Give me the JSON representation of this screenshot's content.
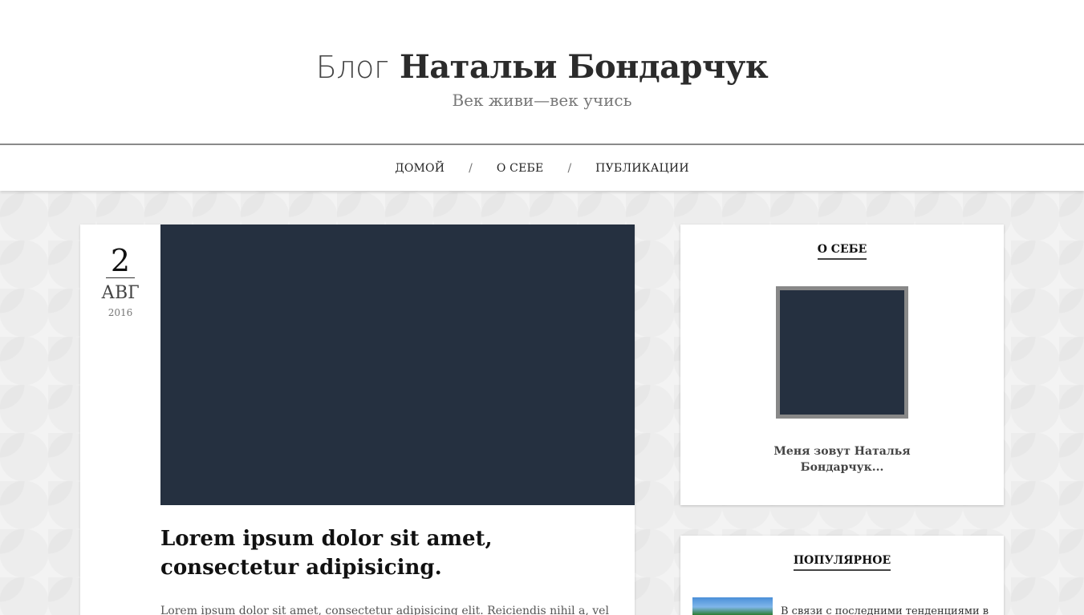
{
  "header": {
    "title_light": "Блог",
    "title_bold": "Натальи Бондарчук",
    "tagline": "Век живи—век учись"
  },
  "nav": {
    "items": [
      "ДОМОЙ",
      "О СЕБЕ",
      "ПУБЛИКАЦИИ"
    ],
    "separator": "/"
  },
  "post": {
    "day": "2",
    "month": "АВГ",
    "year": "2016",
    "title": "Lorem ipsum dolor sit amet, consectetur adipisicing.",
    "excerpt": "Lorem ipsum dolor sit amet, consectetur adipisicing elit. Reiciendis nihil a, vel"
  },
  "sidebar": {
    "about": {
      "title": "О СЕБЕ",
      "text": "Меня зовут Наталья Бондарчук..."
    },
    "popular": {
      "title": "ПОПУЛЯРНОЕ",
      "items": [
        {
          "text": "В связи с последними тенденциями в"
        }
      ]
    }
  },
  "colors": {
    "image_placeholder": "#253040",
    "nav_border": "#8a8a8a",
    "background": "#f3f3f3"
  }
}
